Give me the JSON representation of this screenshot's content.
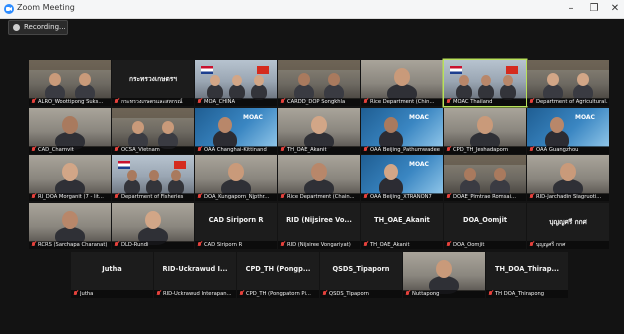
{
  "window": {
    "title": "Zoom Meeting",
    "controls": [
      "–",
      "❐",
      "✕"
    ]
  },
  "recording": {
    "label": "Recording..."
  },
  "colors": {
    "muted_mic": "#e5413c",
    "active_speaker": "#b8e15a",
    "moac_banner": "#2a6fa8"
  },
  "rows": [
    [
      {
        "name": "ALRO_Woottipong Suks...",
        "type": "video",
        "scene": "office"
      },
      {
        "name": "กระทรวงเกษตรและสหกรณ์",
        "type": "name",
        "big": "กระทรวงเกษตรฯ"
      },
      {
        "name": "MOA_CHINA",
        "type": "video",
        "scene": "flags"
      },
      {
        "name": "CARDD_DOP Songkhla",
        "type": "video",
        "scene": "office"
      },
      {
        "name": "Rice Department (Chin...",
        "type": "video",
        "scene": "person"
      },
      {
        "name": "MOAC Thailand",
        "type": "video",
        "scene": "flags",
        "active": true
      },
      {
        "name": "Department of Agricultural...",
        "type": "video",
        "scene": "office"
      }
    ],
    [
      {
        "name": "CAD_Charnvit",
        "type": "video",
        "scene": "person"
      },
      {
        "name": "OCSA_Vietnam",
        "type": "video",
        "scene": "office"
      },
      {
        "name": "OAA Changhai-Kittinand",
        "type": "video",
        "scene": "moac",
        "moac": "MOAC"
      },
      {
        "name": "TH_OAE_Akanit",
        "type": "video",
        "scene": "person"
      },
      {
        "name": "OAA Beijing_Pathumwadee",
        "type": "video",
        "scene": "moac",
        "moac": "MOAC"
      },
      {
        "name": "CPD_TH_Jeshadaporn",
        "type": "video",
        "scene": "person"
      },
      {
        "name": "OAA Guangzhou",
        "type": "video",
        "scene": "moac",
        "moac": "MOAC"
      }
    ],
    [
      {
        "name": "RI_DOA Morganit (7 - lit...",
        "type": "video",
        "scene": "person"
      },
      {
        "name": "Department of Fisheries",
        "type": "video",
        "scene": "flags"
      },
      {
        "name": "DOA_Kungaporn_Njpthr...",
        "type": "video",
        "scene": "person"
      },
      {
        "name": "Rice Department (Chain...",
        "type": "video",
        "scene": "person"
      },
      {
        "name": "OAA Beijing_XTRANON7",
        "type": "video",
        "scene": "moac",
        "moac": "MOAC"
      },
      {
        "name": "DOAE_Pimtrae Romsai...",
        "type": "video",
        "scene": "office"
      },
      {
        "name": "RID-Jarchadin Siagruoti...",
        "type": "video",
        "scene": "person"
      }
    ],
    [
      {
        "name": "RCRS (Sarchapa Charanat)",
        "type": "video",
        "scene": "person"
      },
      {
        "name": "DLD-Rundi",
        "type": "video",
        "scene": "person"
      },
      {
        "name": "CAD Siriporn R",
        "type": "name",
        "big": "CAD Siriporn R"
      },
      {
        "name": "RID (Nijsiree Vongariyat)",
        "type": "name",
        "big": "RID (Nijsiree Vo..."
      },
      {
        "name": "TH_OAE_Akanit",
        "type": "name",
        "big": "TH_OAE_Akanit"
      },
      {
        "name": "DOA_Oomjit",
        "type": "name",
        "big": "DOA_Oomjit"
      },
      {
        "name": "บุญญศรี กกศ",
        "type": "name",
        "big": "บุญญศรี กกศ"
      }
    ],
    [
      {
        "name": "Jutha",
        "type": "name",
        "big": "Jutha"
      },
      {
        "name": "RID-Uckrawud Interapan...",
        "type": "name",
        "big": "RID-Uckrawud I..."
      },
      {
        "name": "CPD_TH (Pongpatorn Pi...",
        "type": "name",
        "big": "CPD_TH (Pongp..."
      },
      {
        "name": "QSDS_Tipaporn",
        "type": "name",
        "big": "QSDS_Tipaporn"
      },
      {
        "name": "Nuttapong",
        "type": "video",
        "scene": "person"
      },
      {
        "name": "TH DOA_Thirapong",
        "type": "name",
        "big": "TH_DOA_Thirap..."
      }
    ]
  ]
}
